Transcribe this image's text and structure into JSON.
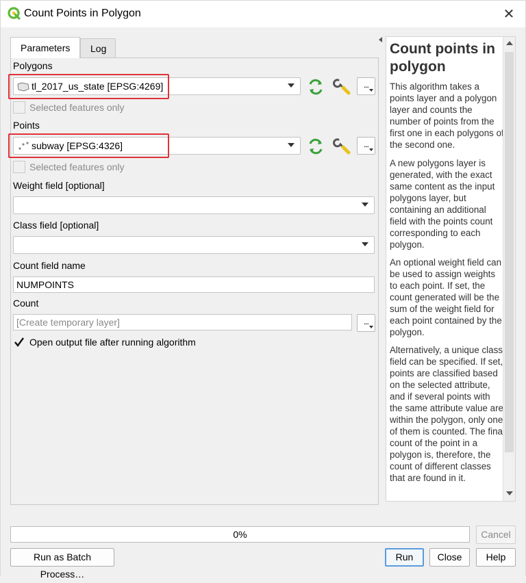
{
  "window": {
    "title": "Count Points in Polygon",
    "close_glyph": "✕"
  },
  "tabs": [
    {
      "label": "Parameters",
      "active": true
    },
    {
      "label": "Log",
      "active": false
    }
  ],
  "polygons": {
    "label": "Polygons",
    "value": "tl_2017_us_state [EPSG:4269]",
    "selected_only_label": "Selected features only",
    "more_button": "..."
  },
  "points": {
    "label": "Points",
    "value": "subway [EPSG:4326]",
    "selected_only_label": "Selected features only",
    "more_button": "..."
  },
  "weight_field": {
    "label": "Weight field [optional]",
    "value": ""
  },
  "class_field": {
    "label": "Class field [optional]",
    "value": ""
  },
  "count_field_name": {
    "label": "Count field name",
    "value": "NUMPOINTS"
  },
  "count_output": {
    "label": "Count",
    "placeholder": "[Create temporary layer]",
    "more_button": "..."
  },
  "open_output": {
    "label": "Open output file after running algorithm",
    "checked": true
  },
  "help": {
    "title": "Count points in polygon",
    "paragraphs": [
      "This algorithm takes a points layer and a polygon layer and counts the number of points from the first one in each polygons of the second one.",
      "A new polygons layer is generated, with the exact same content as the input polygons layer, but containing an additional field with the points count corresponding to each polygon.",
      "An optional weight field can be used to assign weights to each point. If set, the count generated will be the sum of the weight field for each point contained by the polygon.",
      "Alternatively, a unique class field can be specified. If set, points are classified based on the selected attribute, and if several points with the same attribute value are within the polygon, only one of them is counted. The final count of the point in a polygon is, therefore, the count of different classes that are found in it."
    ]
  },
  "progress": {
    "text": "0%",
    "value": 0
  },
  "buttons": {
    "cancel": "Cancel",
    "batch": "Run as Batch Process…",
    "run": "Run",
    "close": "Close",
    "help": "Help"
  },
  "colors": {
    "highlight": "#e0313a",
    "qgis_green": "#5db935",
    "refresh_green": "#3aa13a"
  },
  "icons": {
    "app": "qgis-logo-icon",
    "polygon_layer": "polygon-layer-icon",
    "point_layer": "point-layer-icon",
    "iterate": "iterate-icon",
    "settings": "wrench-icon"
  }
}
